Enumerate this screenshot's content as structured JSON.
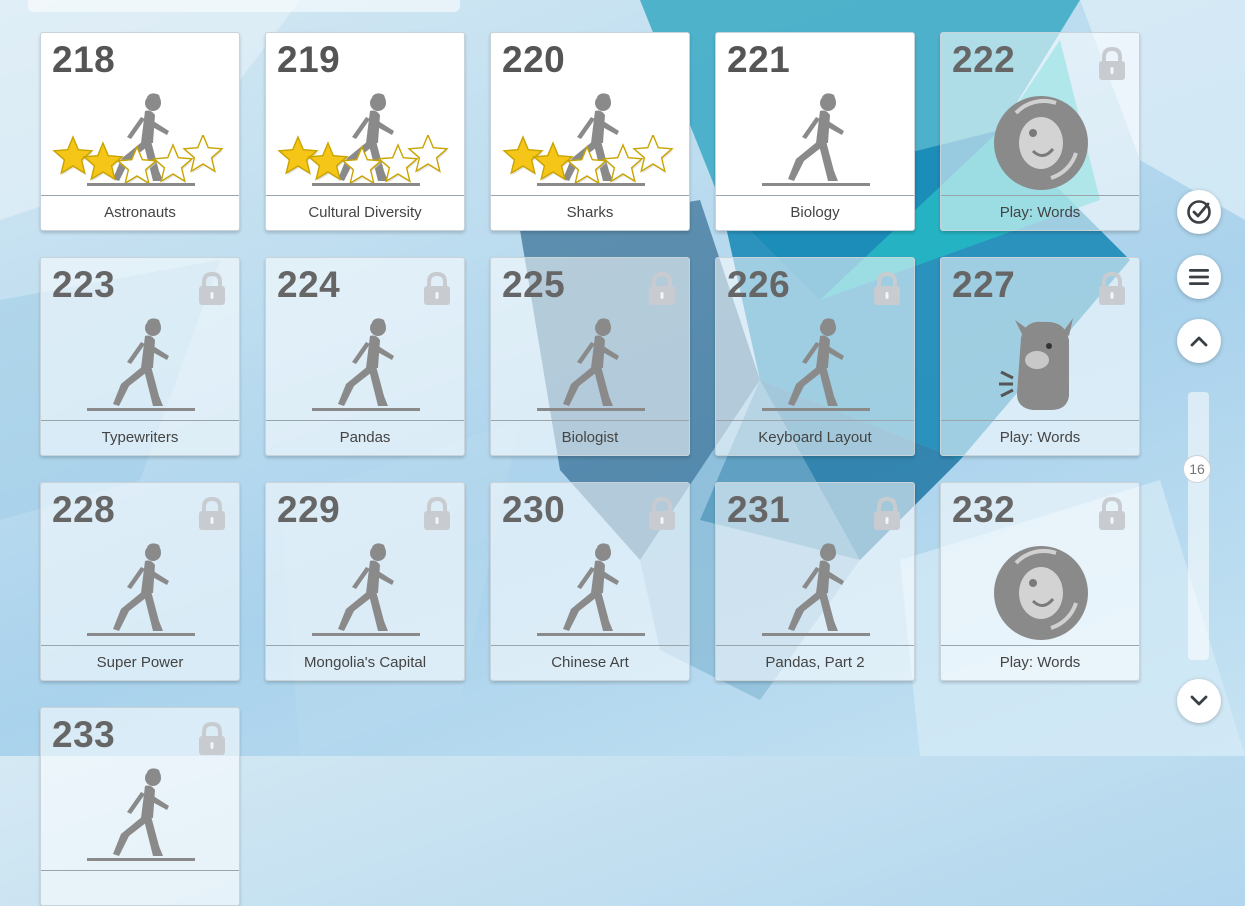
{
  "levels": [
    {
      "number": "218",
      "label": "Astronauts",
      "locked": false,
      "art": "runner-icon",
      "stars": 2,
      "max_stars": 5
    },
    {
      "number": "219",
      "label": "Cultural Diversity",
      "locked": false,
      "art": "runner-icon",
      "stars": 2,
      "max_stars": 5
    },
    {
      "number": "220",
      "label": "Sharks",
      "locked": false,
      "art": "runner-icon",
      "stars": 2,
      "max_stars": 5
    },
    {
      "number": "221",
      "label": "Biology",
      "locked": false,
      "art": "runner-icon",
      "stars": 0,
      "max_stars": 0
    },
    {
      "number": "222",
      "label": "Play: Words",
      "locked": true,
      "art": "game-monster-coin-icon",
      "stars": 0,
      "max_stars": 0
    },
    {
      "number": "223",
      "label": "Typewriters",
      "locked": true,
      "art": "runner-icon",
      "stars": 0,
      "max_stars": 0
    },
    {
      "number": "224",
      "label": "Pandas",
      "locked": true,
      "art": "runner-icon",
      "stars": 0,
      "max_stars": 0
    },
    {
      "number": "225",
      "label": "Biologist",
      "locked": true,
      "art": "runner-icon",
      "stars": 0,
      "max_stars": 0
    },
    {
      "number": "226",
      "label": "Keyboard Layout",
      "locked": true,
      "art": "runner-icon",
      "stars": 0,
      "max_stars": 0
    },
    {
      "number": "227",
      "label": "Play: Words",
      "locked": true,
      "art": "game-monster-icon",
      "stars": 0,
      "max_stars": 0
    },
    {
      "number": "228",
      "label": "Super Power",
      "locked": true,
      "art": "runner-icon",
      "stars": 0,
      "max_stars": 0
    },
    {
      "number": "229",
      "label": "Mongolia's Capital",
      "locked": true,
      "art": "runner-icon",
      "stars": 0,
      "max_stars": 0
    },
    {
      "number": "230",
      "label": "Chinese Art",
      "locked": true,
      "art": "runner-icon",
      "stars": 0,
      "max_stars": 0
    },
    {
      "number": "231",
      "label": "Pandas, Part 2",
      "locked": true,
      "art": "runner-icon",
      "stars": 0,
      "max_stars": 0
    },
    {
      "number": "232",
      "label": "Play: Words",
      "locked": true,
      "art": "game-monster-coin-icon",
      "stars": 0,
      "max_stars": 0
    },
    {
      "number": "233",
      "label": "",
      "locked": true,
      "art": "runner-icon",
      "stars": 0,
      "max_stars": 0
    }
  ],
  "sidebar": {
    "buttons": [
      {
        "name": "checklist-button",
        "icon": "check-circle-icon"
      },
      {
        "name": "menu-button",
        "icon": "hamburger-menu-icon"
      },
      {
        "name": "scroll-up-button",
        "icon": "chevron-up-icon"
      },
      {
        "name": "scroll-down-button",
        "icon": "chevron-down-icon"
      }
    ],
    "page_indicator": "16"
  },
  "colors": {
    "star_fill": "#f5c518",
    "star_empty": "#ffffff",
    "art_gray": "#8a8a8a",
    "lock_gray": "#c8ccd0",
    "icon_dark": "#3a3f44"
  }
}
